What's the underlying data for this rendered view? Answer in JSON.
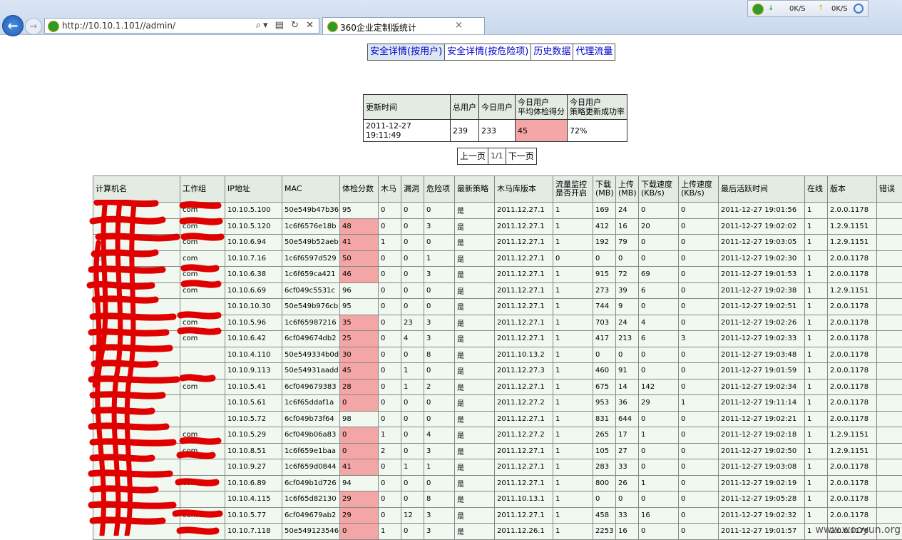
{
  "browser": {
    "url": "http://10.10.1.101//admin/",
    "tab_title": "360企业定制版统计",
    "tab_close": "×",
    "addr_tools": "⌕▾ ▤ ↻ ✕",
    "net_down": "0K/S",
    "net_up": "0K/S"
  },
  "nav": [
    {
      "label": "安全详情(按用户)",
      "active": true
    },
    {
      "label": "安全详情(按危险项)",
      "active": false
    },
    {
      "label": "历史数据",
      "active": false
    },
    {
      "label": "代理流量",
      "active": false
    }
  ],
  "summary": {
    "headers": [
      "更新时间",
      "总用户",
      "今日用户",
      "今日用户\n平均体检得分",
      "今日用户\n策略更新成功率"
    ],
    "values": [
      "2011-12-27 19:11:49",
      "239",
      "233",
      "45",
      "72%"
    ]
  },
  "pager": {
    "prev": "上一页",
    "page": "1/1",
    "next": "下一页"
  },
  "table": {
    "headers": [
      "计算机名",
      "工作组",
      "IP地址",
      "MAC",
      "体检分数",
      "木马",
      "漏洞",
      "危险项",
      "最新策略",
      "木马库版本",
      "流量监控\n是否开启",
      "下载\n(MB)",
      "上传\n(MB)",
      "下载速度\n(KB/s)",
      "上传速度\n(KB/s)",
      "最后活跃时间",
      "在线",
      "版本",
      "错误"
    ],
    "rows": [
      [
        "",
        "com",
        "10.10.5.100",
        "50e549b47b36",
        "95",
        "0",
        "0",
        "0",
        "是",
        "2011.12.27.1",
        "1",
        "169",
        "24",
        "0",
        "0",
        "2011-12-27 19:01:56",
        "1",
        "2.0.0.1178",
        ""
      ],
      [
        "",
        "com",
        "10.10.5.120",
        "1c6f6576e18b",
        "48",
        "0",
        "0",
        "3",
        "是",
        "2011.12.27.1",
        "1",
        "412",
        "16",
        "20",
        "0",
        "2011-12-27 19:02:02",
        "1",
        "1.2.9.1151",
        ""
      ],
      [
        "",
        "com",
        "10.10.6.94",
        "50e549b52aeb",
        "41",
        "1",
        "0",
        "0",
        "是",
        "2011.12.27.1",
        "1",
        "192",
        "79",
        "0",
        "0",
        "2011-12-27 19:03:05",
        "1",
        "1.2.9.1151",
        ""
      ],
      [
        "for",
        "com",
        "10.10.7.16",
        "1c6f6597d529",
        "50",
        "0",
        "0",
        "1",
        "是",
        "2011.12.27.1",
        "0",
        "0",
        "0",
        "0",
        "0",
        "2011-12-27 19:02:30",
        "1",
        "2.0.0.1178",
        ""
      ],
      [
        "",
        "com",
        "10.10.6.38",
        "1c6f659ca421",
        "46",
        "0",
        "0",
        "3",
        "是",
        "2011.12.27.1",
        "1",
        "915",
        "72",
        "69",
        "0",
        "2011-12-27 19:01:53",
        "1",
        "2.0.0.1178",
        ""
      ],
      [
        "",
        "com",
        "10.10.6.69",
        "6cf049c5531c",
        "96",
        "0",
        "0",
        "0",
        "是",
        "2011.12.27.1",
        "1",
        "273",
        "39",
        "6",
        "0",
        "2011-12-27 19:02:38",
        "1",
        "1.2.9.1151",
        ""
      ],
      [
        "",
        "",
        "10.10.10.30",
        "50e549b976cb",
        "95",
        "0",
        "0",
        "0",
        "是",
        "2011.12.27.1",
        "1",
        "744",
        "9",
        "0",
        "0",
        "2011-12-27 19:02:51",
        "1",
        "2.0.0.1178",
        ""
      ],
      [
        "",
        "com",
        "10.10.5.96",
        "1c6f65987216",
        "35",
        "0",
        "23",
        "3",
        "是",
        "2011.12.27.1",
        "1",
        "703",
        "24",
        "4",
        "0",
        "2011-12-27 19:02:26",
        "1",
        "2.0.0.1178",
        ""
      ],
      [
        "",
        "com",
        "10.10.6.42",
        "6cf049674db2",
        "25",
        "0",
        "4",
        "3",
        "是",
        "2011.12.27.1",
        "1",
        "417",
        "213",
        "6",
        "3",
        "2011-12-27 19:02:33",
        "1",
        "2.0.0.1178",
        ""
      ],
      [
        "",
        "",
        "10.10.4.110",
        "50e549334b0d",
        "30",
        "0",
        "0",
        "8",
        "是",
        "2011.10.13.2",
        "1",
        "0",
        "0",
        "0",
        "0",
        "2011-12-27 19:03:48",
        "1",
        "2.0.0.1178",
        ""
      ],
      [
        "",
        "",
        "10.10.9.113",
        "50e54931aadd",
        "45",
        "0",
        "1",
        "0",
        "是",
        "2011.12.27.3",
        "1",
        "460",
        "91",
        "0",
        "0",
        "2011-12-27 19:01:59",
        "1",
        "2.0.0.1178",
        ""
      ],
      [
        "",
        "com",
        "10.10.5.41",
        "6cf049679383",
        "28",
        "0",
        "1",
        "2",
        "是",
        "2011.12.27.1",
        "1",
        "675",
        "14",
        "142",
        "0",
        "2011-12-27 19:02:34",
        "1",
        "2.0.0.1178",
        ""
      ],
      [
        "",
        "",
        "10.10.5.61",
        "1c6f65ddaf1a",
        "0",
        "0",
        "0",
        "0",
        "是",
        "2011.12.27.2",
        "1",
        "953",
        "36",
        "29",
        "1",
        "2011-12-27 19:11:14",
        "1",
        "2.0.0.1178",
        ""
      ],
      [
        "",
        "",
        "10.10.5.72",
        "6cf049b73f64",
        "98",
        "0",
        "0",
        "0",
        "是",
        "2011.12.27.1",
        "1",
        "831",
        "644",
        "0",
        "0",
        "2011-12-27 19:02:21",
        "1",
        "2.0.0.1178",
        ""
      ],
      [
        "",
        "com",
        "10.10.5.29",
        "6cf049b06a83",
        "0",
        "1",
        "0",
        "4",
        "是",
        "2011.12.27.2",
        "1",
        "265",
        "17",
        "1",
        "0",
        "2011-12-27 19:02:18",
        "1",
        "1.2.9.1151",
        ""
      ],
      [
        "",
        "com",
        "10.10.8.51",
        "1c6f659e1baa",
        "0",
        "2",
        "0",
        "3",
        "是",
        "2011.12.27.1",
        "1",
        "105",
        "27",
        "0",
        "0",
        "2011-12-27 19:02:50",
        "1",
        "1.2.9.1151",
        ""
      ],
      [
        "",
        "",
        "10.10.9.27",
        "1c6f659d0844",
        "41",
        "0",
        "1",
        "1",
        "是",
        "2011.12.27.1",
        "1",
        "283",
        "33",
        "0",
        "0",
        "2011-12-27 19:03:08",
        "1",
        "2.0.0.1178",
        ""
      ],
      [
        "",
        "com",
        "10.10.6.89",
        "6cf049b1d726",
        "94",
        "0",
        "0",
        "0",
        "是",
        "2011.12.27.1",
        "1",
        "800",
        "26",
        "1",
        "0",
        "2011-12-27 19:02:19",
        "1",
        "2.0.0.1178",
        ""
      ],
      [
        "",
        "",
        "10.10.4.115",
        "1c6f65d82130",
        "29",
        "0",
        "0",
        "8",
        "是",
        "2011.10.13.1",
        "1",
        "0",
        "0",
        "0",
        "0",
        "2011-12-27 19:05:28",
        "1",
        "2.0.0.1178",
        ""
      ],
      [
        "",
        "com",
        "10.10.5.77",
        "6cf049679ab2",
        "29",
        "0",
        "12",
        "3",
        "是",
        "2011.12.27.1",
        "1",
        "458",
        "33",
        "16",
        "0",
        "2011-12-27 19:02:32",
        "1",
        "2.0.0.1178",
        ""
      ],
      [
        "",
        "com",
        "10.10.7.118",
        "50e549123546",
        "0",
        "1",
        "0",
        "3",
        "是",
        "2011.12.26.1",
        "1",
        "2253",
        "16",
        "0",
        "0",
        "2011-12-27 19:01:57",
        "1",
        "2.0.0.1178",
        ""
      ]
    ]
  },
  "watermark": "www.wooyun.org",
  "colors": {
    "low_score": "#f4a5a5",
    "header_bg": "#e3ebe3",
    "row_bg": "#f0f8f0",
    "link": "#0000cc",
    "redaction": "#e00000"
  }
}
